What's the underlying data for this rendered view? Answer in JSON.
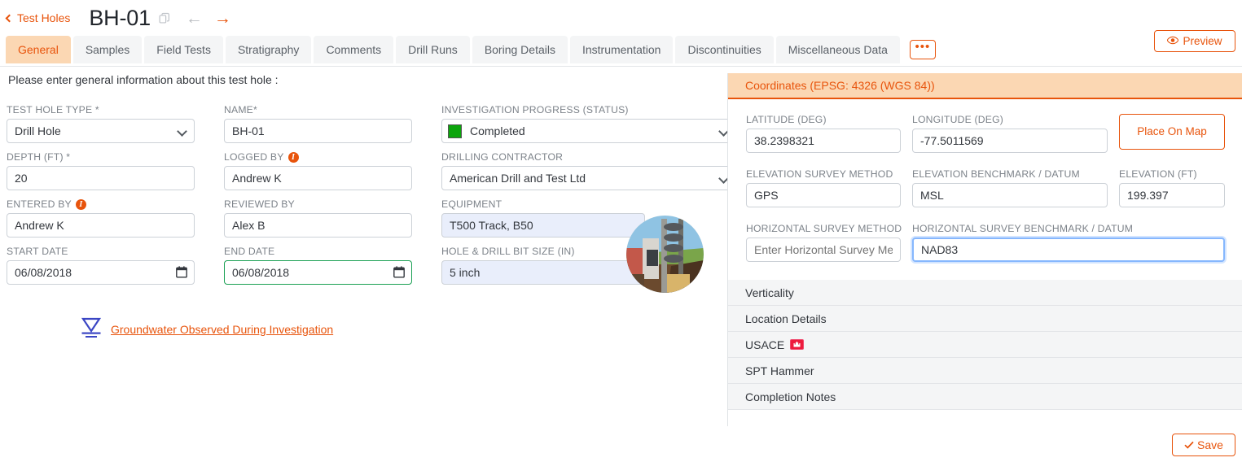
{
  "header": {
    "back_label": "Test Holes",
    "record_title": "BH-01",
    "copy_icon": "copy-icon",
    "prev_icon": "arrow-left-icon",
    "next_icon": "arrow-right-icon",
    "preview_label": "Preview",
    "preview_icon": "eye-icon"
  },
  "tabs": [
    {
      "label": "General",
      "active": true
    },
    {
      "label": "Samples",
      "active": false
    },
    {
      "label": "Field Tests",
      "active": false
    },
    {
      "label": "Stratigraphy",
      "active": false
    },
    {
      "label": "Comments",
      "active": false
    },
    {
      "label": "Drill Runs",
      "active": false
    },
    {
      "label": "Boring Details",
      "active": false
    },
    {
      "label": "Instrumentation",
      "active": false
    },
    {
      "label": "Discontinuities",
      "active": false
    },
    {
      "label": "Miscellaneous Data",
      "active": false
    }
  ],
  "tabs_more_label": "•••",
  "main": {
    "intro": "Please enter general information about this test hole :",
    "fields": {
      "test_hole_type": {
        "label": "TEST HOLE TYPE *",
        "value": "Drill Hole",
        "type": "select"
      },
      "name": {
        "label": "NAME*",
        "value": "BH-01",
        "type": "text"
      },
      "investigation_progress": {
        "label": "INVESTIGATION PROGRESS (STATUS)",
        "value": "Completed",
        "type": "select",
        "status_color": "#0ca50c"
      },
      "depth": {
        "label": "DEPTH (FT) *",
        "value": "20",
        "type": "text"
      },
      "logged_by": {
        "label": "LOGGED BY",
        "value": "Andrew K",
        "type": "text",
        "info": true
      },
      "drilling_contractor": {
        "label": "DRILLING CONTRACTOR",
        "value": "American Drill and Test Ltd",
        "type": "select"
      },
      "entered_by": {
        "label": "ENTERED BY",
        "value": "Andrew K",
        "type": "text",
        "info": true
      },
      "reviewed_by": {
        "label": "REVIEWED BY",
        "value": "Alex B",
        "type": "text"
      },
      "equipment": {
        "label": "EQUIPMENT",
        "value": "T500 Track, B50",
        "type": "readonly"
      },
      "start_date": {
        "label": "START DATE",
        "value": "06/08/2018",
        "type": "date"
      },
      "end_date": {
        "label": "END DATE",
        "value": "06/08/2018",
        "type": "date",
        "valid": true
      },
      "hole_bit_size": {
        "label": "HOLE & DRILL BIT SIZE (IN)",
        "value": "5 inch",
        "type": "readonly"
      }
    },
    "groundwater_link": "Groundwater Observed During Investigation",
    "groundwater_icon": "water-table-icon",
    "equipment_thumbnail": "drill-rig-photo"
  },
  "right": {
    "coordinates_header": "Coordinates (EPSG: 4326 (WGS 84))",
    "fields": {
      "latitude": {
        "label": "LATITUDE (DEG)",
        "value": "38.2398321"
      },
      "longitude": {
        "label": "LONGITUDE (DEG)",
        "value": "-77.5011569"
      },
      "elevation_survey_method": {
        "label": "ELEVATION SURVEY METHOD",
        "value": "GPS"
      },
      "elevation_benchmark": {
        "label": "ELEVATION BENCHMARK / DATUM",
        "value": "MSL"
      },
      "elevation": {
        "label": "ELEVATION (FT)",
        "value": "199.397"
      },
      "horizontal_survey_method": {
        "label": "HORIZONTAL SURVEY METHOD",
        "value": "",
        "placeholder": "Enter Horizontal Survey Method"
      },
      "horizontal_benchmark": {
        "label": "HORIZONTAL SURVEY BENCHMARK / DATUM",
        "value": "NAD83",
        "focused": true
      }
    },
    "place_on_map_label": "Place On Map",
    "sections": [
      {
        "label": "Verticality",
        "badge": null
      },
      {
        "label": "Location Details",
        "badge": null
      },
      {
        "label": "USACE",
        "badge": "usace-icon"
      },
      {
        "label": "SPT Hammer",
        "badge": null
      },
      {
        "label": "Completion Notes",
        "badge": null
      }
    ]
  },
  "footer": {
    "save_label": "Save",
    "save_icon": "check-icon"
  },
  "colors": {
    "accent": "#e8540c",
    "active_tab_bg": "#fbd7b3",
    "status_green": "#0ca50c",
    "readonly_bg": "#e9eefb",
    "valid_border": "#1aa053",
    "usace_red": "#ed1c3d"
  }
}
